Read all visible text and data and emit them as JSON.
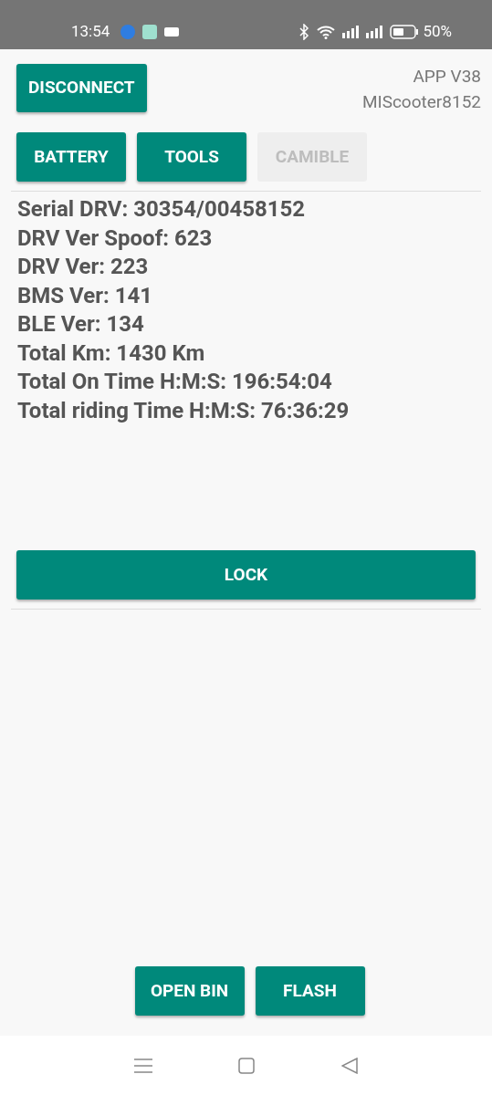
{
  "status_bar": {
    "time": "13:54",
    "battery": "50%"
  },
  "header": {
    "disconnect": "DISCONNECT",
    "app_version": "APP V38",
    "device": "MIScooter8152"
  },
  "tabs": [
    {
      "label": "BATTERY",
      "disabled": false
    },
    {
      "label": "TOOLS",
      "disabled": false
    },
    {
      "label": "CAMIBLE",
      "disabled": true
    }
  ],
  "info": [
    "Serial DRV: 30354/00458152",
    "DRV Ver Spoof: 623",
    "DRV Ver: 223",
    "BMS Ver: 141",
    "BLE Ver: 134",
    "Total Km: 1430 Km",
    "Total On Time H:M:S: 196:54:04",
    "Total riding Time H:M:S: 76:36:29"
  ],
  "lock_button": "LOCK",
  "bottom_buttons": [
    "OPEN BIN",
    "FLASH"
  ]
}
